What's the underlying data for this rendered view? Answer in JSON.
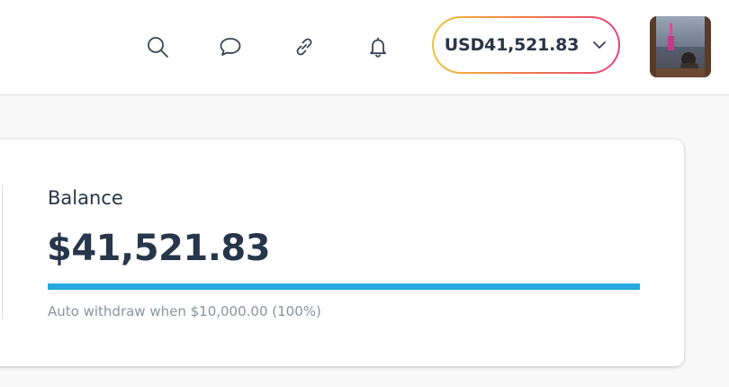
{
  "header": {
    "icons": [
      "search-icon",
      "chat-bubble-icon",
      "link-icon",
      "bell-icon",
      "chevron-down-icon"
    ],
    "balance_pill": {
      "label": "USD41,521.83",
      "gradient": [
        "#f1c232",
        "#ee7b4a",
        "#e0457a"
      ]
    },
    "avatar": {
      "kind": "user-photo"
    }
  },
  "balance_card": {
    "title": "Balance",
    "amount": "$41,521.83",
    "progress_percent": 100,
    "progress_color": "#25a9e0",
    "auto_withdraw_note": "Auto withdraw when $10,000.00 (100%)"
  }
}
